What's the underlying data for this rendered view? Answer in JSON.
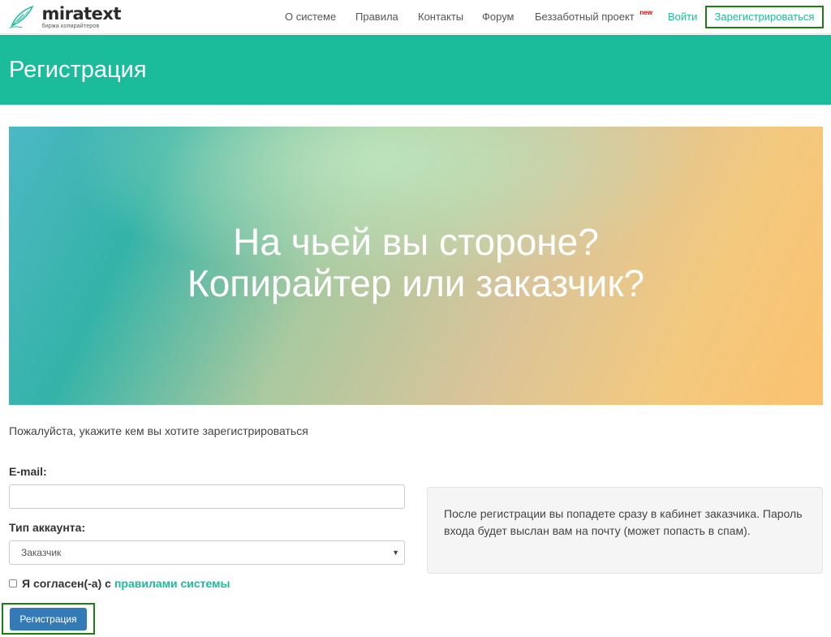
{
  "logo": {
    "name": "miratext",
    "subtitle": "биржа копирайтеров"
  },
  "nav": {
    "items": [
      {
        "label": "О системе"
      },
      {
        "label": "Правила"
      },
      {
        "label": "Контакты"
      },
      {
        "label": "Форум"
      },
      {
        "label": "Беззаботный проект",
        "badge": "new"
      }
    ],
    "login": "Войти",
    "register": "Зарегистрироваться"
  },
  "header": {
    "title": "Регистрация"
  },
  "banner": {
    "line1": "На чьей вы стороне?",
    "line2": "Копирайтер или заказчик?"
  },
  "form": {
    "intro": "Пожалуйста, укажите кем вы хотите зарегистрироваться",
    "email_label": "E-mail:",
    "email_value": "",
    "account_type_label": "Тип аккаунта:",
    "account_type_value": "Заказчик",
    "agree_text": "Я согласен(-а) с",
    "agree_link": "правилами системы",
    "submit_label": "Регистрация"
  },
  "info": {
    "text": "После регистрации вы попадете сразу в кабинет заказчика. Пароль входа будет выслан вам на почту (может попасть в спам)."
  },
  "colors": {
    "accent": "#1abc9c",
    "primary_button": "#337ab7",
    "badge_new": "#ee0000",
    "highlight_border": "#1e7d12"
  }
}
